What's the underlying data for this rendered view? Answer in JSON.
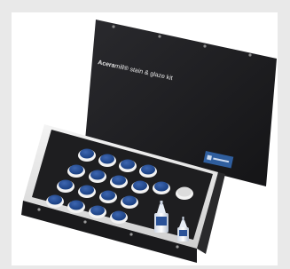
{
  "product": {
    "title_bold": "Acera",
    "title_rest": "mill® stain & glaze kit",
    "badge_color": "#2f5e9e",
    "case_color": "#1b1b1d",
    "lid_color": "#1f1f22",
    "jar_lid_color": "#234a8f",
    "bottle_cap_color": "#274f99",
    "jar_count": 18,
    "bottle_count": 2
  }
}
